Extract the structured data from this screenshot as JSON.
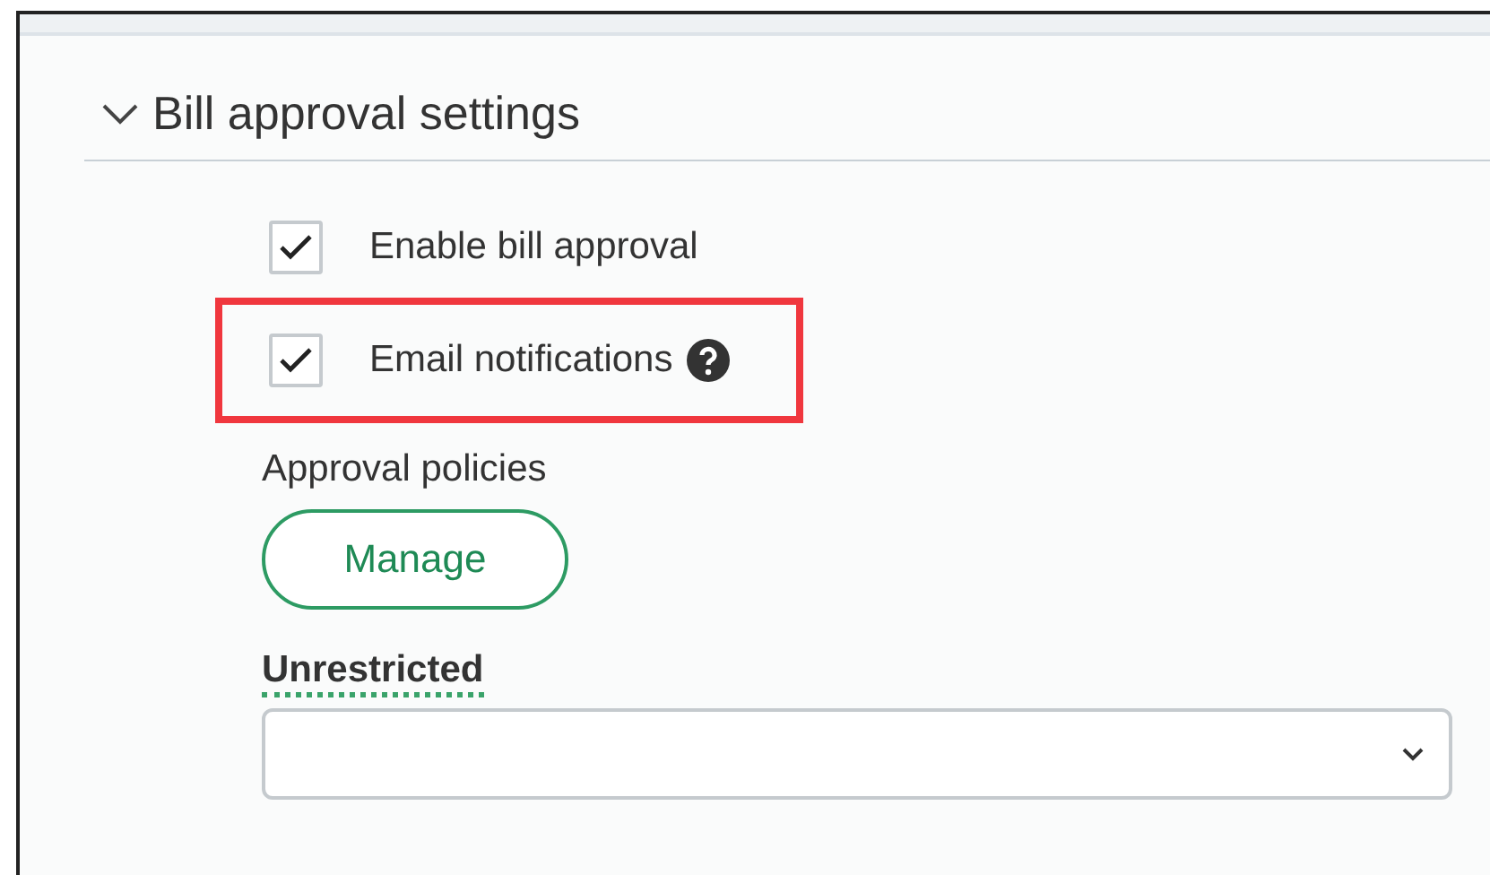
{
  "section": {
    "title": "Bill approval settings",
    "expanded": true
  },
  "options": [
    {
      "label": "Enable bill approval",
      "checked": true,
      "highlighted": false,
      "help": false
    },
    {
      "label": "Email notifications",
      "checked": true,
      "highlighted": true,
      "help": true
    }
  ],
  "policies": {
    "label": "Approval policies",
    "button": "Manage"
  },
  "restriction": {
    "label": "Unrestricted"
  }
}
